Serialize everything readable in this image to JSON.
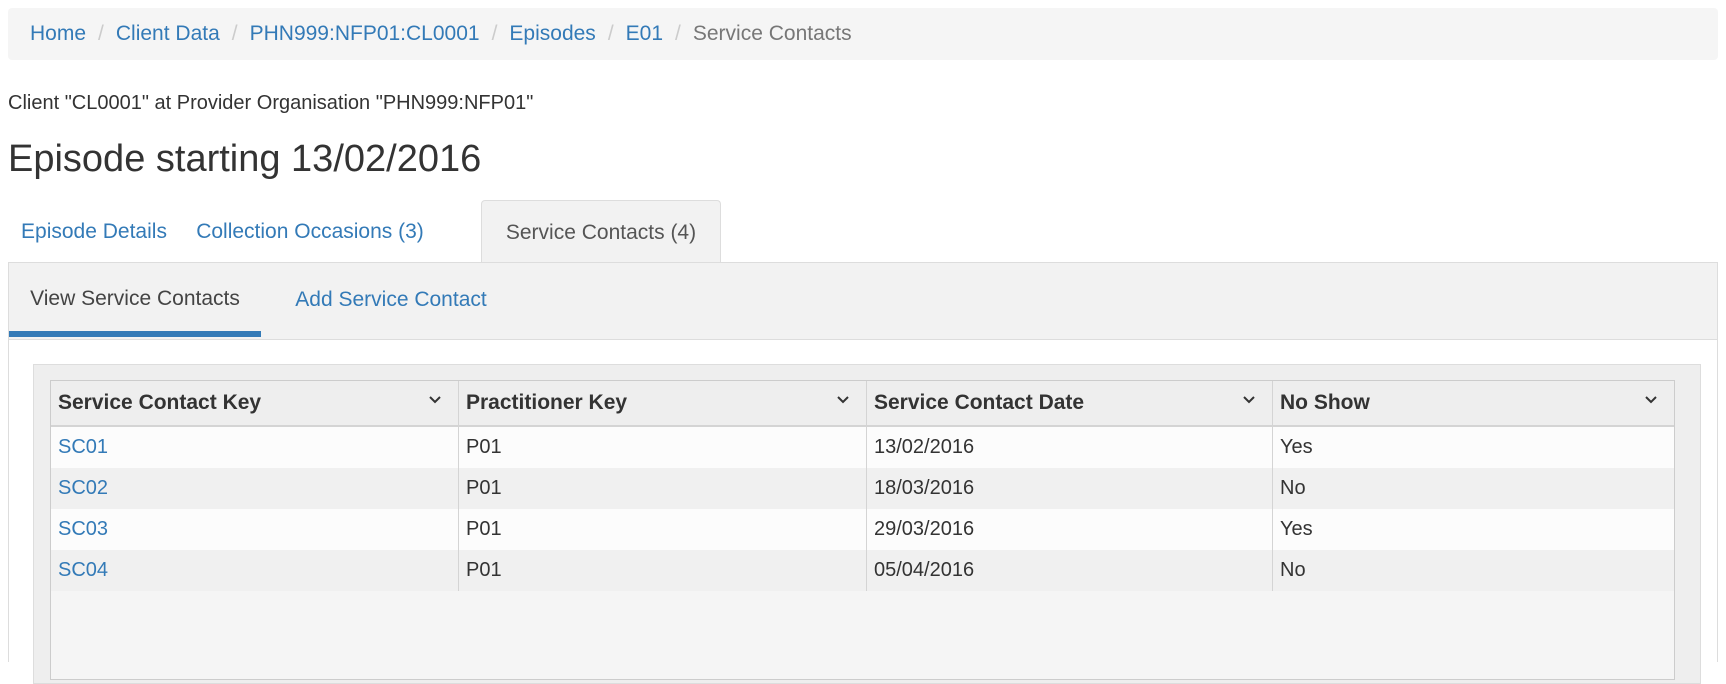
{
  "breadcrumb": {
    "items": [
      "Home",
      "Client Data",
      "PHN999:NFP01:CL0001",
      "Episodes",
      "E01"
    ],
    "separator": "/",
    "current": "Service Contacts"
  },
  "client_line": "Client \"CL0001\" at Provider Organisation \"PHN999:NFP01\"",
  "page_title": "Episode starting 13/02/2016",
  "tabs": [
    {
      "label": "Episode Details"
    },
    {
      "label": "Collection Occasions (3)"
    },
    {
      "label": "Service Contacts (4)"
    }
  ],
  "subtabs": [
    {
      "label": "View Service Contacts"
    },
    {
      "label": "Add Service Contact"
    }
  ],
  "table": {
    "columns": [
      "Service Contact Key",
      "Practitioner Key",
      "Service Contact Date",
      "No Show"
    ],
    "rows": [
      [
        "SC01",
        "P01",
        "13/02/2016",
        "Yes"
      ],
      [
        "SC02",
        "P01",
        "18/03/2016",
        "No"
      ],
      [
        "SC03",
        "P01",
        "29/03/2016",
        "Yes"
      ],
      [
        "SC04",
        "P01",
        "05/04/2016",
        "No"
      ]
    ]
  },
  "colors": {
    "link": "#337ab7",
    "active_underline": "#337ab7"
  },
  "icons": {
    "column_menu": "chevron-down-icon"
  }
}
